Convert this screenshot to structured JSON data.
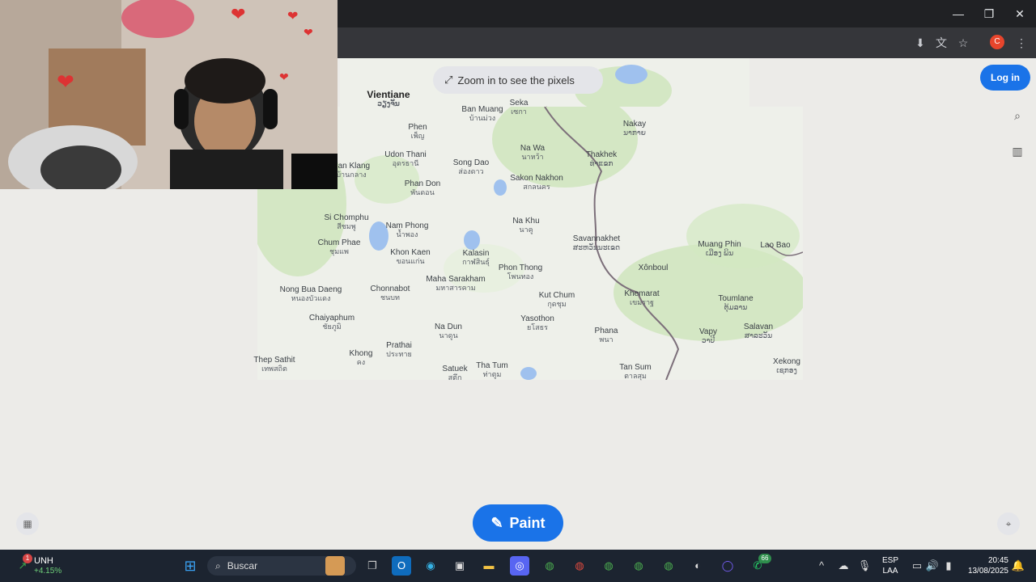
{
  "window": {
    "minimize": "—",
    "restore": "❐",
    "close": "✕"
  },
  "toolbar": {
    "profile_initial": "C"
  },
  "page": {
    "zoom_hint": "Zoom in to see the pixels",
    "login_label": "Log in",
    "paint_label": "Paint"
  },
  "map_labels": [
    {
      "name": "Vientiane",
      "th": "ວຽງຈັນ",
      "big": true
    },
    {
      "name": "Ban Muang",
      "th": "บ้านม่วง"
    },
    {
      "name": "Seka",
      "th": "เซกา"
    },
    {
      "name": "Phen",
      "th": "เพ็ญ"
    },
    {
      "name": "Nakay",
      "th": "ນາກາຍ"
    },
    {
      "name": "Na Wa",
      "th": "นาหว้า"
    },
    {
      "name": "Thakhek",
      "th": "ທ່າແຂກ"
    },
    {
      "name": "Udon Thani",
      "th": "อุดรธานี"
    },
    {
      "name": "Song Dao",
      "th": "ส่องดาว"
    },
    {
      "name": "Sakon Nakhon",
      "th": "สกลนคร"
    },
    {
      "name": "Ban Klang",
      "th": "บ้านกลาง"
    },
    {
      "name": "Phan Don",
      "th": "พันดอน"
    },
    {
      "name": "Si Chomphu",
      "th": "สีชมพู"
    },
    {
      "name": "Nam Phong",
      "th": "น้ำพอง"
    },
    {
      "name": "Na Khu",
      "th": "นาคู"
    },
    {
      "name": "Savannakhet",
      "th": "ສະຫວັນນະເຂດ"
    },
    {
      "name": "Muang Phin",
      "th": "ເມືອງ ພິນ"
    },
    {
      "name": "Lao Bao",
      "th": ""
    },
    {
      "name": "Chum Phae",
      "th": "ชุมแพ"
    },
    {
      "name": "Khon Kaen",
      "th": "ขอนแก่น"
    },
    {
      "name": "Kalasin",
      "th": "กาฬสินธุ์"
    },
    {
      "name": "Phon Thong",
      "th": "โพนทอง"
    },
    {
      "name": "Xônboul",
      "th": ""
    },
    {
      "name": "Maha Sarakham",
      "th": "มหาสารคาม"
    },
    {
      "name": "Nong Bua Daeng",
      "th": "หนองบัวแดง"
    },
    {
      "name": "Chonnabot",
      "th": "ชนบท"
    },
    {
      "name": "Kut Chum",
      "th": "กุดชุม"
    },
    {
      "name": "Khemarat",
      "th": "เขมราฐ"
    },
    {
      "name": "Toumlane",
      "th": "ຕຸ້ມລານ"
    },
    {
      "name": "Chaiyaphum",
      "th": "ชัยภูมิ"
    },
    {
      "name": "Yasothon",
      "th": "ยโสธร"
    },
    {
      "name": "Na Dun",
      "th": "นาดูน"
    },
    {
      "name": "Phana",
      "th": "พนา"
    },
    {
      "name": "Vapy",
      "th": "ວາປີ"
    },
    {
      "name": "Salavan",
      "th": "ສາລະວັນ"
    },
    {
      "name": "Prathai",
      "th": "ประทาย"
    },
    {
      "name": "Thep Sathit",
      "th": "เทพสถิต"
    },
    {
      "name": "Khong",
      "th": "คง"
    },
    {
      "name": "Tan Sum",
      "th": "ตาลสุม"
    },
    {
      "name": "Xekong",
      "th": "ເຊກອງ"
    },
    {
      "name": "Satuek",
      "th": "สตึก"
    },
    {
      "name": "Tha Tum",
      "th": "ท่าตูม"
    }
  ],
  "taskbar": {
    "stock_name": "UNH",
    "stock_change": "+4.15%",
    "stock_badge": "1",
    "search_placeholder": "Buscar",
    "lang_top": "ESP",
    "lang_bottom": "LAA",
    "time": "20:45",
    "date": "13/08/2025",
    "whatsapp_badge": "66"
  },
  "colors": {
    "accent": "#1a73e8",
    "map_green": "#c9e3b4",
    "water": "#9fc1ee",
    "border": "#7c6f7a"
  }
}
